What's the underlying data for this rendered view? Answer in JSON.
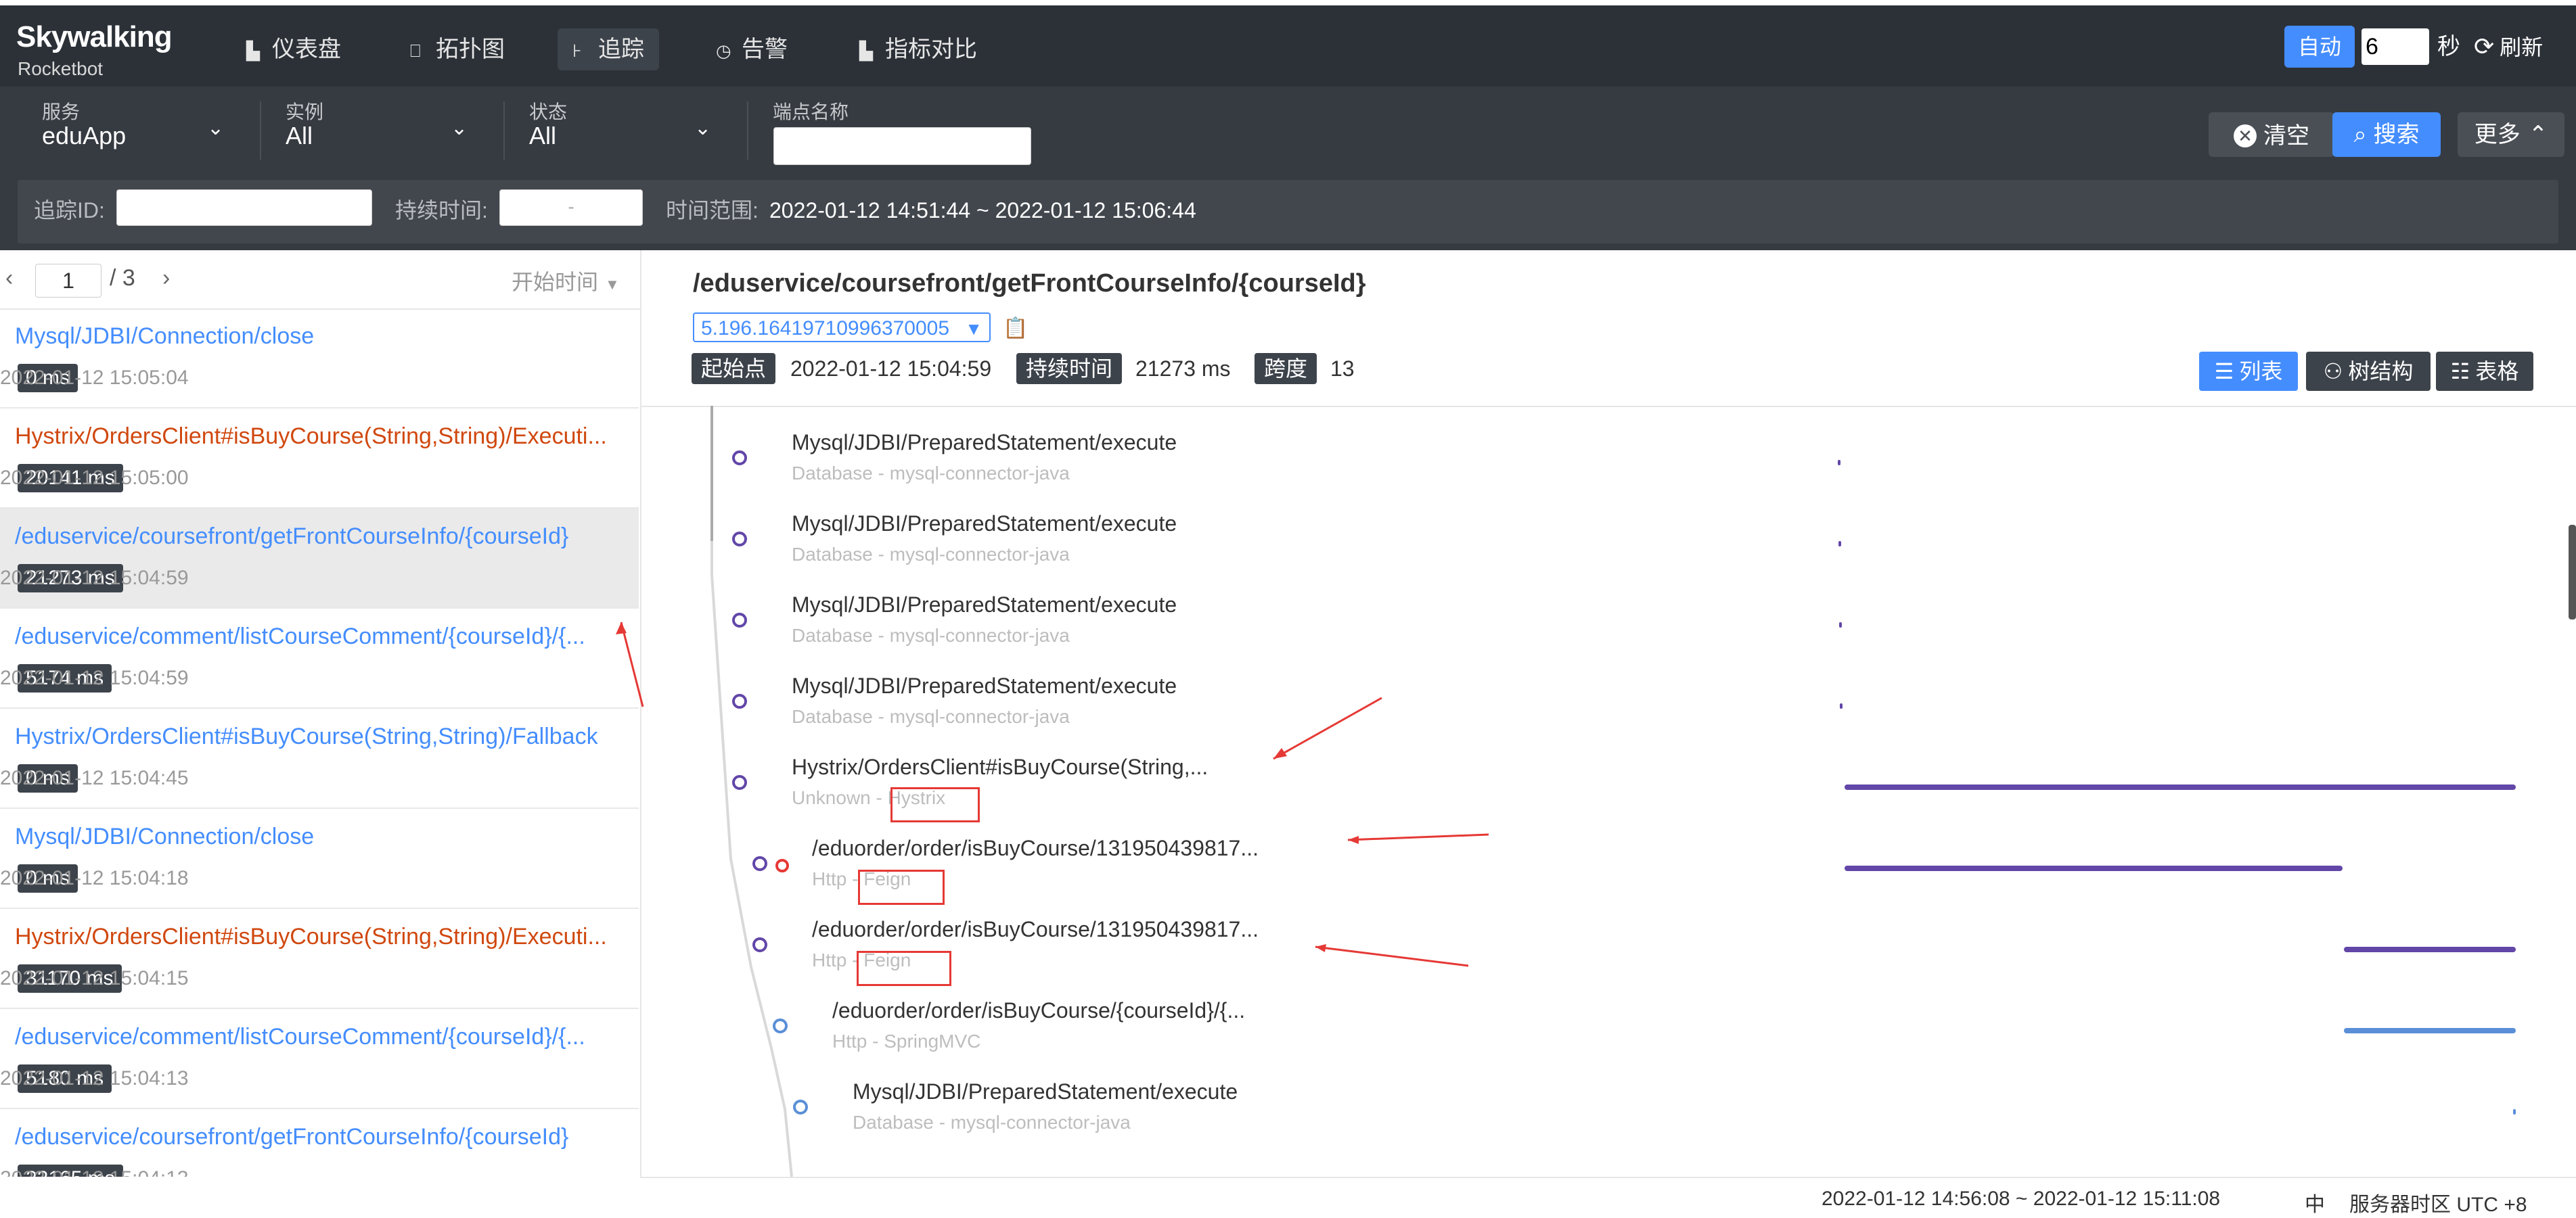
{
  "app": {
    "logo": "Skywalking",
    "logo_sub": "Rocketbot"
  },
  "nav": {
    "items": [
      {
        "label": "仪表盘",
        "icon": "dashboard-icon"
      },
      {
        "label": "拓扑图",
        "icon": "topology-icon"
      },
      {
        "label": "追踪",
        "icon": "trace-icon"
      },
      {
        "label": "告警",
        "icon": "alarm-icon"
      },
      {
        "label": "指标对比",
        "icon": "compare-icon"
      }
    ],
    "active": "追踪"
  },
  "header_right": {
    "auto_label": "自动",
    "interval_value": "6",
    "interval_unit": "秒",
    "refresh_label": "刷新"
  },
  "filters": {
    "service_label": "服务",
    "service_value": "eduApp",
    "instance_label": "实例",
    "instance_value": "All",
    "status_label": "状态",
    "status_value": "All",
    "endpoint_label": "端点名称",
    "endpoint_value": "",
    "clear_label": "清空",
    "search_label": "搜索",
    "more_label": "更多"
  },
  "filters2": {
    "trace_id_label": "追踪ID:",
    "trace_id_value": "",
    "duration_label": "持续时间:",
    "duration_sep": "-",
    "time_range_label": "时间范围:",
    "time_range_value": "2022-01-12 14:51:44 ~ 2022-01-12 15:06:44"
  },
  "pager": {
    "current": "1",
    "total": "/ 3",
    "sort_label": "开始时间"
  },
  "traces": [
    {
      "title": "Mysql/JDBI/Connection/close",
      "color": "#448dfe",
      "duration": "0 ms",
      "time": "2022-01-12 15:05:04"
    },
    {
      "title": "Hystrix/OrdersClient#isBuyCourse(String,String)/Executi...",
      "color": "#d0480f",
      "duration": "20141 ms",
      "time": "2022-01-12 15:05:00"
    },
    {
      "title": "/eduservice/coursefront/getFrontCourseInfo/{courseId}",
      "color": "#448dfe",
      "duration": "21273 ms",
      "time": "2022-01-12 15:04:59"
    },
    {
      "title": "/eduservice/comment/listCourseComment/{courseId}/{...",
      "color": "#448dfe",
      "duration": "5174 ms",
      "time": "2022-01-12 15:04:59"
    },
    {
      "title": "Hystrix/OrdersClient#isBuyCourse(String,String)/Fallback",
      "color": "#448dfe",
      "duration": "0 ms",
      "time": "2022-01-12 15:04:45"
    },
    {
      "title": "Mysql/JDBI/Connection/close",
      "color": "#448dfe",
      "duration": "0 ms",
      "time": "2022-01-12 15:04:18"
    },
    {
      "title": "Hystrix/OrdersClient#isBuyCourse(String,String)/Executi...",
      "color": "#d0480f",
      "duration": "31170 ms",
      "time": "2022-01-12 15:04:15"
    },
    {
      "title": "/eduservice/comment/listCourseComment/{courseId}/{...",
      "color": "#448dfe",
      "duration": "5180 ms",
      "time": "2022-01-12 15:04:13"
    },
    {
      "title": "/eduservice/coursefront/getFrontCourseInfo/{courseId}",
      "color": "#448dfe",
      "duration": "22165 ms",
      "time": "2022-01-12 15:04:13"
    }
  ],
  "detail": {
    "title": "/eduservice/coursefront/getFrontCourseInfo/{courseId}",
    "trace_id": "5.196.16419710996370005",
    "start_label": "起始点",
    "start_value": "2022-01-12 15:04:59",
    "duration_label": "持续时间",
    "duration_value": "21273 ms",
    "span_label": "跨度",
    "span_value": "13",
    "view_list": "列表",
    "view_tree": "树结构",
    "view_table": "表格"
  },
  "spans": [
    {
      "name": "Mysql/JDBI/PreparedStatement/execute",
      "sub": "Database - mysql-connector-java",
      "start": 0.0,
      "end": 0.001,
      "color": "#6246a8"
    },
    {
      "name": "Mysql/JDBI/PreparedStatement/execute",
      "sub": "Database - mysql-connector-java",
      "start": 0.001,
      "end": 0.002,
      "color": "#6246a8"
    },
    {
      "name": "Mysql/JDBI/PreparedStatement/execute",
      "sub": "Database - mysql-connector-java",
      "start": 0.002,
      "end": 0.003,
      "color": "#6246a8"
    },
    {
      "name": "Mysql/JDBI/PreparedStatement/execute",
      "sub": "Database - mysql-connector-java",
      "start": 0.003,
      "end": 0.004,
      "color": "#6246a8"
    },
    {
      "name": "Hystrix/OrdersClient#isBuyCourse(String,...",
      "sub": "Unknown - Hystrix",
      "start": 0.01,
      "end": 1.0,
      "color": "#6246a8"
    },
    {
      "name": "/eduorder/order/isBuyCourse/131950439817...",
      "sub": "Http - Feign",
      "start": 0.01,
      "end": 0.745,
      "color": "#6246a8"
    },
    {
      "name": "/eduorder/order/isBuyCourse/131950439817...",
      "sub": "Http - Feign",
      "start": 0.747,
      "end": 1.0,
      "color": "#6246a8"
    },
    {
      "name": "/eduorder/order/isBuyCourse/{courseId}/{...",
      "sub": "Http - SpringMVC",
      "start": 0.747,
      "end": 1.0,
      "color": "#5a8fd8"
    },
    {
      "name": "Mysql/JDBI/PreparedStatement/execute",
      "sub": "Database - mysql-connector-java",
      "start": 0.996,
      "end": 0.999,
      "color": "#5a8fd8"
    }
  ],
  "status_bar": {
    "time_range": "2022-01-12 14:56:08 ~ 2022-01-12 15:11:08",
    "lang": "中",
    "timezone": "服务器时区 UTC +8"
  }
}
